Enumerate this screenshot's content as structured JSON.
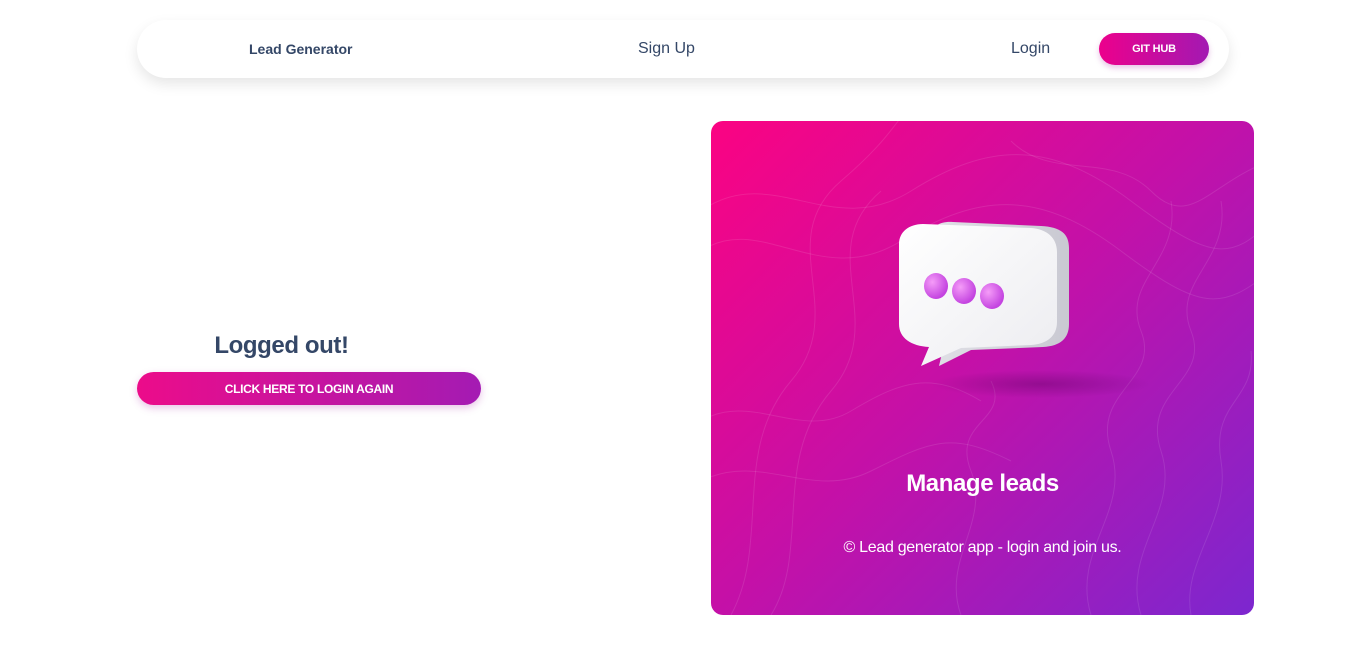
{
  "navbar": {
    "brand": "Lead Generator",
    "signup_label": "Sign Up",
    "login_label": "Login",
    "github_label": "GIT HUB"
  },
  "main": {
    "status_title": "Logged out!",
    "login_again_label": "CLICK HERE TO LOGIN AGAIN"
  },
  "panel": {
    "title": "Manage leads",
    "footer": "© Lead generator app - login and join us."
  },
  "icons": {
    "panel_illustration": "chat-bubble-icon"
  },
  "colors": {
    "text_dark": "#344767",
    "gradient_start": "#fb0382",
    "gradient_mid": "#c211a9",
    "gradient_end": "#7c27cf"
  }
}
